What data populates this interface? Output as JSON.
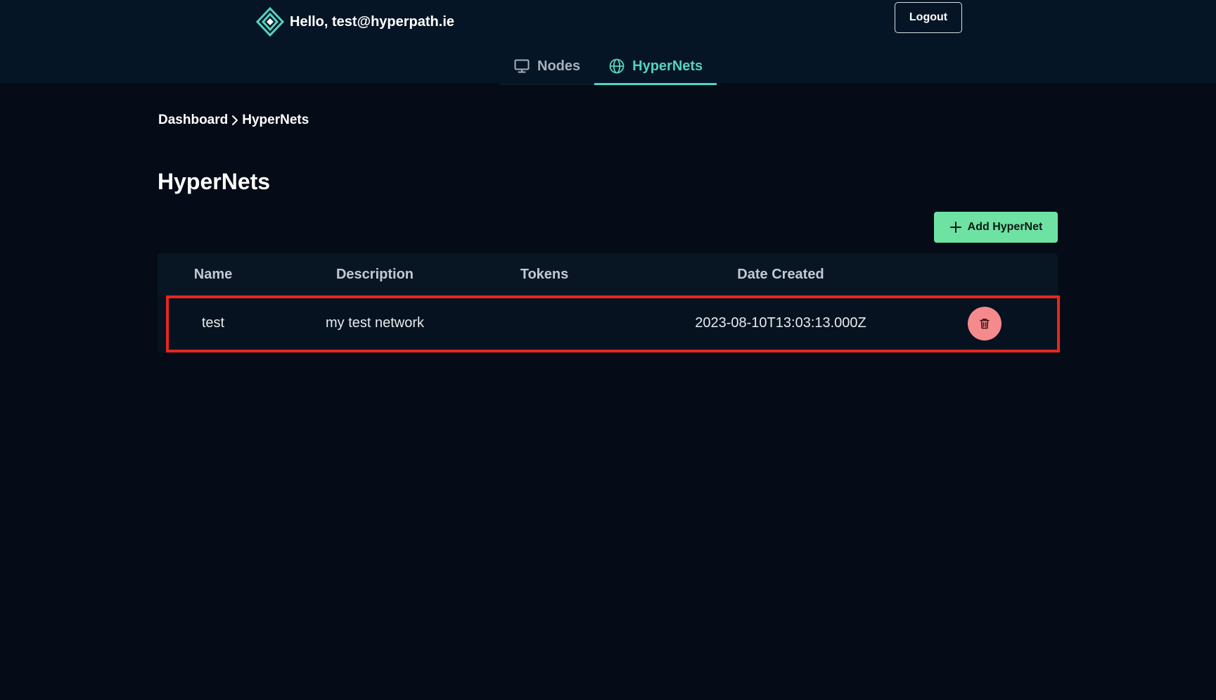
{
  "header": {
    "greeting": "Hello, test@hyperpath.ie",
    "logo_icon": "diamond-logo-icon",
    "logout_label": "Logout"
  },
  "tabs": [
    {
      "label": "Nodes",
      "icon": "monitor-icon",
      "active": false
    },
    {
      "label": "HyperNets",
      "icon": "globe-icon",
      "active": true
    }
  ],
  "breadcrumb": {
    "items": [
      "Dashboard",
      "HyperNets"
    ],
    "separator_icon": "chevron-right-icon"
  },
  "page": {
    "title": "HyperNets",
    "add_button_label": "Add HyperNet",
    "add_button_icon": "plus-icon"
  },
  "table": {
    "columns": [
      "Name",
      "Description",
      "Tokens",
      "Date Created"
    ],
    "rows": [
      {
        "name": "test",
        "description": "my test network",
        "tokens": "",
        "date_created": "2023-08-10T13:03:13.000Z",
        "action_icon": "trash-icon"
      }
    ]
  },
  "colors": {
    "background": "#050c17",
    "header_bg": "#061525",
    "accent": "#52d4bd",
    "add_button": "#6ee2a2",
    "delete_button": "#f58a8c",
    "highlight": "#e8261c"
  }
}
